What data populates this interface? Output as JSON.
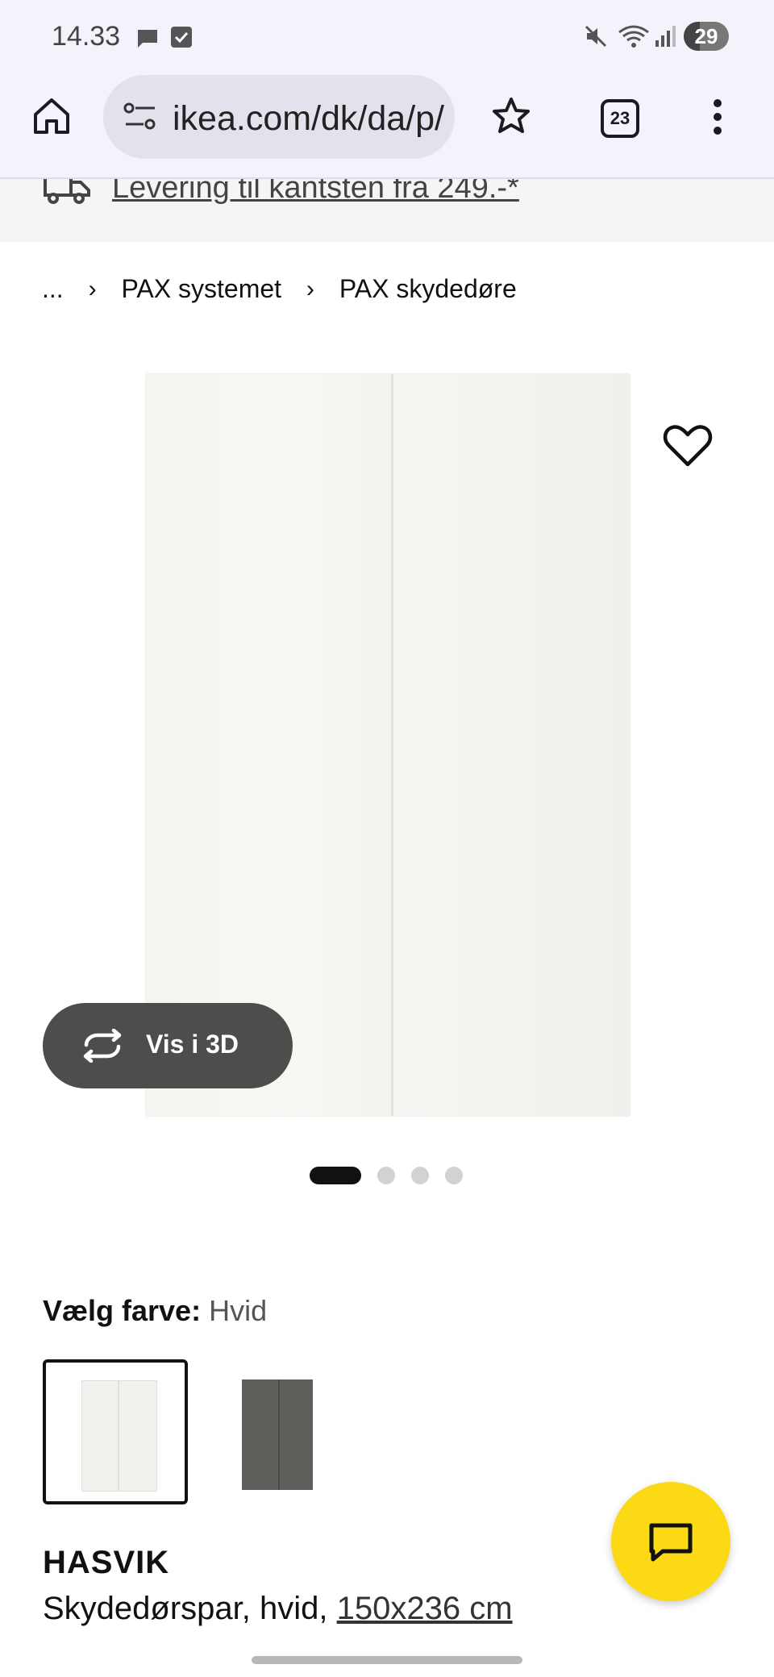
{
  "status_bar": {
    "time": "14.33",
    "battery": "29"
  },
  "browser": {
    "url": "ikea.com/dk/da/p/",
    "tab_count": "23"
  },
  "delivery_banner": {
    "text": "Levering til kantsten fra 249.-*"
  },
  "breadcrumb": {
    "ellipsis": "...",
    "items": [
      "PAX systemet",
      "PAX skydedøre"
    ]
  },
  "gallery": {
    "view_3d_label": "Vis i 3D",
    "image_count": 4,
    "active_index": 0
  },
  "color_select": {
    "label": "Vælg farve:",
    "value": "Hvid",
    "options": [
      "Hvid",
      "Grå"
    ]
  },
  "product": {
    "name": "HASVIK",
    "description": "Skydedørspar, hvid,",
    "size": "150x236 cm"
  },
  "colors": {
    "accent": "#fbd914",
    "dark_button": "#4d4d4b"
  }
}
